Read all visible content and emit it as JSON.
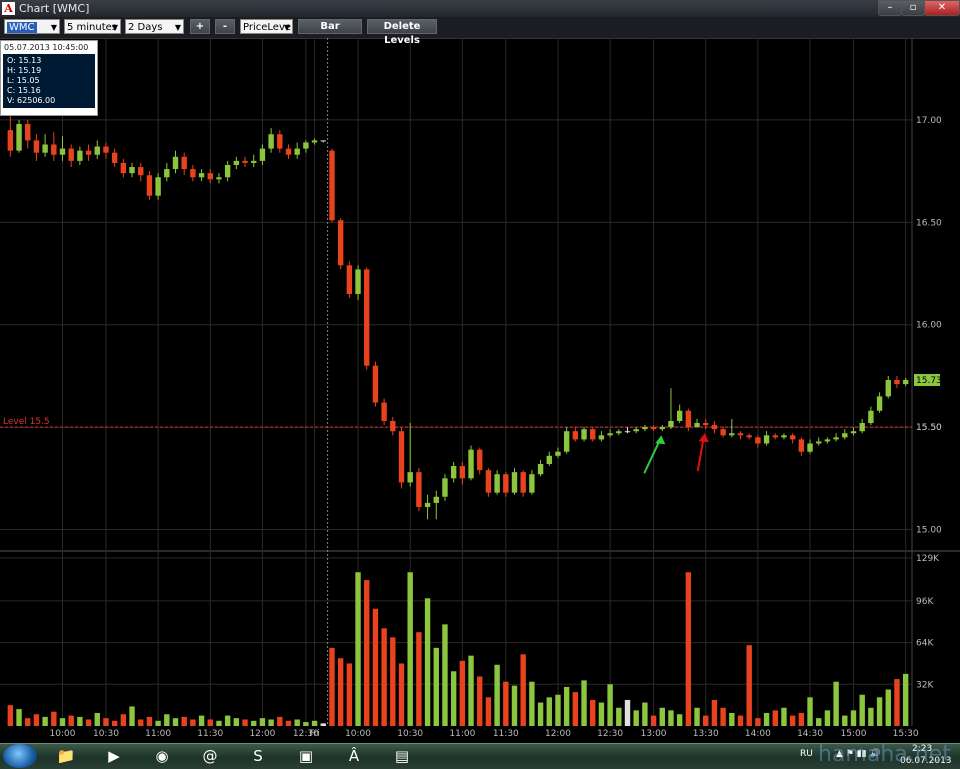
{
  "window": {
    "title": "Chart [WMC]",
    "app_icon": "A"
  },
  "toolbar": {
    "symbol": "WMC",
    "interval": "5 minutes",
    "range": "2 Days",
    "plus_label": "+",
    "minus_label": "-",
    "mode": "PriceLeve",
    "bar_label": "Bar",
    "delete_levels_label": "Delete Levels"
  },
  "ohlc_box": {
    "timestamp": "05.07.2013 10:45:00",
    "open": "O: 15.13",
    "high": "H: 15.19",
    "low": "L: 15.05",
    "close": "C: 15.16",
    "volume": "V: 62506.00"
  },
  "chart_data": {
    "type": "candlestick",
    "price_axis": {
      "ticks": [
        "17.00",
        "16.50",
        "16.00",
        "15.50",
        "15.00"
      ],
      "range": [
        14.9,
        17.4
      ]
    },
    "volume_axis": {
      "ticks": [
        "129K",
        "96K",
        "64K",
        "32K"
      ],
      "range": [
        0,
        132000
      ]
    },
    "time_axis": [
      "10:00",
      "10:30",
      "11:00",
      "11:30",
      "12:00",
      "12:30",
      "Fri",
      "10:00",
      "10:30",
      "11:00",
      "11:30",
      "12:00",
      "12:30",
      "13:00",
      "13:30",
      "14:00",
      "14:30",
      "15:00",
      "15:30"
    ],
    "level_line": {
      "label": "Level 15.5",
      "price_label": "15.50",
      "value": 15.5,
      "color": "#e03030"
    },
    "last_price": {
      "label": "15.73",
      "value": 15.73,
      "color": "#8cc63f"
    },
    "session_divider_label": "Fri",
    "colors": {
      "up": "#8cc63f",
      "down": "#e8431e",
      "neutral": "#e0e0e0",
      "grid": "#2a2a2a"
    },
    "candles": [
      [
        16.95,
        16.85,
        17.02,
        16.82
      ],
      [
        16.85,
        16.98,
        17.0,
        16.84
      ],
      [
        16.98,
        16.9,
        17.0,
        16.86
      ],
      [
        16.9,
        16.84,
        16.93,
        16.8
      ],
      [
        16.84,
        16.88,
        16.93,
        16.82
      ],
      [
        16.88,
        16.83,
        16.94,
        16.8
      ],
      [
        16.83,
        16.86,
        16.92,
        16.8
      ],
      [
        16.86,
        16.8,
        16.88,
        16.77
      ],
      [
        16.8,
        16.85,
        16.87,
        16.78
      ],
      [
        16.85,
        16.83,
        16.88,
        16.8
      ],
      [
        16.83,
        16.87,
        16.9,
        16.81
      ],
      [
        16.87,
        16.84,
        16.89,
        16.81
      ],
      [
        16.84,
        16.79,
        16.86,
        16.77
      ],
      [
        16.79,
        16.74,
        16.81,
        16.72
      ],
      [
        16.74,
        16.77,
        16.79,
        16.72
      ],
      [
        16.77,
        16.73,
        16.79,
        16.7
      ],
      [
        16.73,
        16.63,
        16.75,
        16.61
      ],
      [
        16.63,
        16.72,
        16.74,
        16.61
      ],
      [
        16.72,
        16.76,
        16.79,
        16.7
      ],
      [
        16.76,
        16.82,
        16.85,
        16.74
      ],
      [
        16.82,
        16.76,
        16.84,
        16.73
      ],
      [
        16.76,
        16.72,
        16.78,
        16.7
      ],
      [
        16.72,
        16.74,
        16.76,
        16.7
      ],
      [
        16.74,
        16.71,
        16.76,
        16.69
      ],
      [
        16.71,
        16.72,
        16.74,
        16.69
      ],
      [
        16.72,
        16.78,
        16.8,
        16.7
      ],
      [
        16.78,
        16.8,
        16.82,
        16.76
      ],
      [
        16.8,
        16.79,
        16.82,
        16.77
      ],
      [
        16.79,
        16.8,
        16.83,
        16.77
      ],
      [
        16.8,
        16.86,
        16.88,
        16.78
      ],
      [
        16.86,
        16.93,
        16.96,
        16.84
      ],
      [
        16.93,
        16.86,
        16.95,
        16.84
      ],
      [
        16.86,
        16.83,
        16.88,
        16.81
      ],
      [
        16.83,
        16.86,
        16.89,
        16.81
      ],
      [
        16.86,
        16.89,
        16.9,
        16.84
      ],
      [
        16.89,
        16.9,
        16.91,
        16.88
      ],
      [
        16.9,
        16.9,
        16.9,
        16.89
      ],
      [
        16.85,
        16.51,
        16.86,
        16.5
      ],
      [
        16.51,
        16.29,
        16.52,
        16.27
      ],
      [
        16.29,
        16.15,
        16.31,
        16.13
      ],
      [
        16.15,
        16.27,
        16.29,
        16.12
      ],
      [
        16.27,
        15.8,
        16.28,
        15.78
      ],
      [
        15.8,
        15.62,
        15.82,
        15.6
      ],
      [
        15.62,
        15.53,
        15.64,
        15.51
      ],
      [
        15.53,
        15.48,
        15.55,
        15.46
      ],
      [
        15.48,
        15.23,
        15.5,
        15.2
      ],
      [
        15.23,
        15.28,
        15.52,
        15.21
      ],
      [
        15.28,
        15.11,
        15.3,
        15.09
      ],
      [
        15.11,
        15.13,
        15.17,
        15.05
      ],
      [
        15.13,
        15.16,
        15.19,
        15.05
      ],
      [
        15.16,
        15.25,
        15.27,
        15.14
      ],
      [
        15.25,
        15.31,
        15.33,
        15.23
      ],
      [
        15.31,
        15.25,
        15.33,
        15.22
      ],
      [
        15.25,
        15.39,
        15.41,
        15.24
      ],
      [
        15.39,
        15.29,
        15.4,
        15.27
      ],
      [
        15.29,
        15.18,
        15.3,
        15.16
      ],
      [
        15.18,
        15.27,
        15.29,
        15.17
      ],
      [
        15.27,
        15.18,
        15.28,
        15.16
      ],
      [
        15.18,
        15.28,
        15.3,
        15.17
      ],
      [
        15.28,
        15.18,
        15.29,
        15.16
      ],
      [
        15.18,
        15.27,
        15.29,
        15.17
      ],
      [
        15.27,
        15.32,
        15.34,
        15.26
      ],
      [
        15.32,
        15.36,
        15.38,
        15.31
      ],
      [
        15.36,
        15.38,
        15.4,
        15.35
      ],
      [
        15.38,
        15.48,
        15.5,
        15.37
      ],
      [
        15.48,
        15.44,
        15.5,
        15.43
      ],
      [
        15.44,
        15.49,
        15.5,
        15.43
      ],
      [
        15.49,
        15.44,
        15.5,
        15.43
      ],
      [
        15.44,
        15.46,
        15.48,
        15.43
      ],
      [
        15.46,
        15.47,
        15.49,
        15.45
      ],
      [
        15.47,
        15.48,
        15.49,
        15.46
      ],
      [
        15.48,
        15.48,
        15.5,
        15.47
      ],
      [
        15.48,
        15.49,
        15.5,
        15.47
      ],
      [
        15.49,
        15.5,
        15.51,
        15.48
      ],
      [
        15.5,
        15.49,
        15.51,
        15.48
      ],
      [
        15.49,
        15.5,
        15.51,
        15.48
      ],
      [
        15.5,
        15.53,
        15.69,
        15.49
      ],
      [
        15.53,
        15.58,
        15.61,
        15.52
      ],
      [
        15.58,
        15.5,
        15.59,
        15.48
      ],
      [
        15.5,
        15.52,
        15.54,
        15.5
      ],
      [
        15.52,
        15.51,
        15.54,
        15.49
      ],
      [
        15.51,
        15.49,
        15.53,
        15.47
      ],
      [
        15.49,
        15.46,
        15.5,
        15.45
      ],
      [
        15.46,
        15.47,
        15.54,
        15.45
      ],
      [
        15.47,
        15.46,
        15.48,
        15.44
      ],
      [
        15.46,
        15.45,
        15.47,
        15.44
      ],
      [
        15.45,
        15.42,
        15.46,
        15.4
      ],
      [
        15.42,
        15.46,
        15.48,
        15.41
      ],
      [
        15.46,
        15.45,
        15.47,
        15.44
      ],
      [
        15.45,
        15.46,
        15.47,
        15.44
      ],
      [
        15.46,
        15.44,
        15.47,
        15.42
      ],
      [
        15.44,
        15.38,
        15.45,
        15.36
      ],
      [
        15.38,
        15.42,
        15.44,
        15.37
      ],
      [
        15.42,
        15.43,
        15.45,
        15.41
      ],
      [
        15.43,
        15.44,
        15.45,
        15.42
      ],
      [
        15.44,
        15.45,
        15.47,
        15.43
      ],
      [
        15.45,
        15.47,
        15.49,
        15.44
      ],
      [
        15.47,
        15.48,
        15.5,
        15.46
      ],
      [
        15.48,
        15.52,
        15.54,
        15.47
      ],
      [
        15.52,
        15.58,
        15.6,
        15.51
      ],
      [
        15.58,
        15.65,
        15.67,
        15.57
      ],
      [
        15.65,
        15.73,
        15.75,
        15.64
      ],
      [
        15.73,
        15.71,
        15.75,
        15.69
      ],
      [
        15.71,
        15.73,
        15.74,
        15.7
      ]
    ],
    "volume": [
      16000,
      13000,
      6000,
      9000,
      7000,
      11000,
      6000,
      8000,
      7000,
      5000,
      10000,
      6000,
      4000,
      9000,
      15000,
      5000,
      7000,
      4000,
      9000,
      6000,
      7000,
      5000,
      8000,
      5000,
      4000,
      8000,
      6000,
      5000,
      4000,
      6000,
      5000,
      7000,
      4000,
      5000,
      3000,
      4000,
      2000,
      60000,
      52000,
      48000,
      118000,
      112000,
      90000,
      75000,
      68000,
      48000,
      118000,
      72000,
      98000,
      60000,
      78000,
      42000,
      50000,
      54000,
      38000,
      22000,
      47000,
      34000,
      31000,
      55000,
      34000,
      18000,
      22000,
      24000,
      30000,
      26000,
      35000,
      20000,
      18000,
      32000,
      14000,
      20000,
      12000,
      18000,
      8000,
      14000,
      12000,
      9000,
      118000,
      14000,
      8000,
      20000,
      14000,
      10000,
      8000,
      62000,
      6000,
      10000,
      12000,
      14000,
      8000,
      10000,
      22000,
      6000,
      12000,
      34000,
      8000,
      12000,
      24000,
      14000,
      22000,
      28000,
      36000,
      40000
    ],
    "volume_colors": "same_as_candles",
    "annotations": [
      {
        "type": "green-arrow",
        "at_index": 75
      },
      {
        "type": "red-arrow",
        "at_index": 80
      }
    ]
  },
  "taskbar": {
    "items": [
      {
        "name": "start-button",
        "icon": "windows-orb"
      },
      {
        "name": "explorer-taskbar-icon",
        "icon": "folder",
        "glyph": "📁"
      },
      {
        "name": "media-player-taskbar-icon",
        "icon": "play",
        "glyph": "▶"
      },
      {
        "name": "chrome-taskbar-icon",
        "icon": "chrome",
        "glyph": "◉"
      },
      {
        "name": "icq-taskbar-icon",
        "icon": "icq",
        "glyph": "@"
      },
      {
        "name": "skype-taskbar-icon",
        "icon": "skype",
        "glyph": "S"
      },
      {
        "name": "remote-desktop-taskbar-icon",
        "icon": "remote-desktop",
        "glyph": "▣"
      },
      {
        "name": "trading-app-taskbar-icon",
        "icon": "app-a",
        "glyph": "Â"
      },
      {
        "name": "book-taskbar-icon",
        "icon": "book",
        "glyph": "▤"
      }
    ],
    "language": "RU",
    "time": "2:23",
    "date": "06.07.2013"
  },
  "watermark": "hamaha.net"
}
